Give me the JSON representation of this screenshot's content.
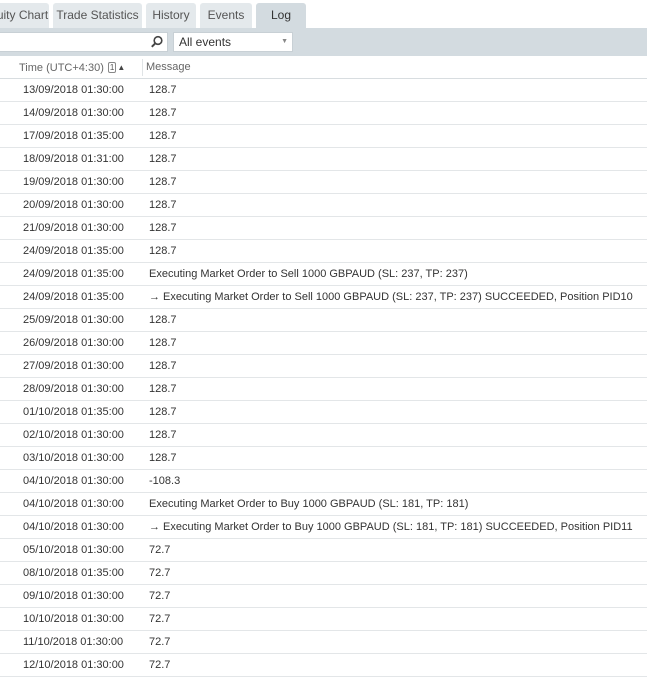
{
  "tabs": [
    {
      "label": "uity Chart"
    },
    {
      "label": "Trade Statistics"
    },
    {
      "label": "History"
    },
    {
      "label": "Events"
    },
    {
      "label": "Log",
      "active": true
    }
  ],
  "toolbar": {
    "search_value": "",
    "filter_selected": "All events"
  },
  "table": {
    "columns": {
      "time": "Time (UTC+4:30)",
      "sort_badge": "1",
      "message": "Message"
    },
    "rows": [
      {
        "time": "13/09/2018 01:30:00",
        "message": "128.7"
      },
      {
        "time": "14/09/2018 01:30:00",
        "message": "128.7"
      },
      {
        "time": "17/09/2018 01:35:00",
        "message": "128.7"
      },
      {
        "time": "18/09/2018 01:31:00",
        "message": "128.7"
      },
      {
        "time": "19/09/2018 01:30:00",
        "message": "128.7"
      },
      {
        "time": "20/09/2018 01:30:00",
        "message": "128.7"
      },
      {
        "time": "21/09/2018 01:30:00",
        "message": "128.7"
      },
      {
        "time": "24/09/2018 01:35:00",
        "message": "128.7"
      },
      {
        "time": "24/09/2018 01:35:00",
        "message": "Executing Market Order to Sell 1000 GBPAUD (SL: 237, TP: 237)"
      },
      {
        "time": "24/09/2018 01:35:00",
        "message": "→ Executing Market Order to Sell 1000 GBPAUD (SL: 237, TP: 237) SUCCEEDED, Position PID10"
      },
      {
        "time": "25/09/2018 01:30:00",
        "message": "128.7"
      },
      {
        "time": "26/09/2018 01:30:00",
        "message": "128.7"
      },
      {
        "time": "27/09/2018 01:30:00",
        "message": "128.7"
      },
      {
        "time": "28/09/2018 01:30:00",
        "message": "128.7"
      },
      {
        "time": "01/10/2018 01:35:00",
        "message": "128.7"
      },
      {
        "time": "02/10/2018 01:30:00",
        "message": "128.7"
      },
      {
        "time": "03/10/2018 01:30:00",
        "message": "128.7"
      },
      {
        "time": "04/10/2018 01:30:00",
        "message": "-108.3"
      },
      {
        "time": "04/10/2018 01:30:00",
        "message": "Executing Market Order to Buy 1000 GBPAUD (SL: 181, TP: 181)"
      },
      {
        "time": "04/10/2018 01:30:00",
        "message": "→ Executing Market Order to Buy 1000 GBPAUD (SL: 181, TP: 181) SUCCEEDED, Position PID11"
      },
      {
        "time": "05/10/2018 01:30:00",
        "message": "72.7"
      },
      {
        "time": "08/10/2018 01:35:00",
        "message": "72.7"
      },
      {
        "time": "09/10/2018 01:30:00",
        "message": "72.7"
      },
      {
        "time": "10/10/2018 01:30:00",
        "message": "72.7"
      },
      {
        "time": "11/10/2018 01:30:00",
        "message": "72.7"
      },
      {
        "time": "12/10/2018 01:30:00",
        "message": "72.7"
      }
    ]
  }
}
